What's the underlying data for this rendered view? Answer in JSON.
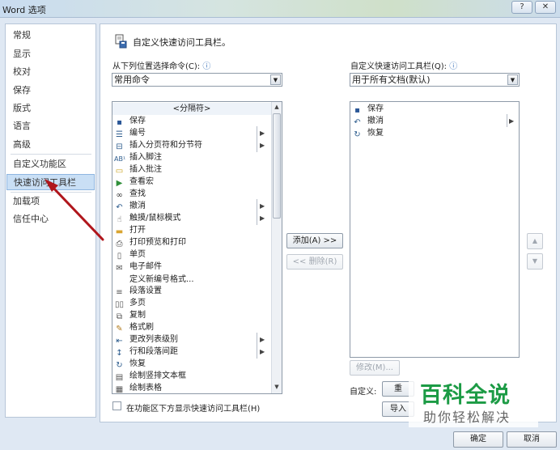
{
  "window": {
    "title": "Word 选项",
    "help_label": "?",
    "close_label": "✕"
  },
  "sidebar": {
    "items": [
      {
        "label": "常规",
        "icon": ""
      },
      {
        "label": "显示"
      },
      {
        "label": "校对"
      },
      {
        "label": "保存"
      },
      {
        "label": "版式"
      },
      {
        "label": "语言"
      },
      {
        "label": "高级"
      },
      {
        "label": "自定义功能区"
      },
      {
        "label": "快速访问工具栏"
      },
      {
        "label": "加载项"
      },
      {
        "label": "信任中心"
      }
    ]
  },
  "main": {
    "heading": "自定义快速访问工具栏。",
    "choose_label": "从下列位置选择命令(C):",
    "choose_value": "常用命令",
    "customize_label": "自定义快速访问工具栏(Q):",
    "customize_value": "用于所有文档(默认)",
    "commands": [
      {
        "label": "<分隔符>",
        "icon": ""
      },
      {
        "label": "保存",
        "icon": "save-icon"
      },
      {
        "label": "编号",
        "icon": "numbering-icon",
        "submenu": true
      },
      {
        "label": "插入分页符和分节符",
        "icon": "page-break-icon",
        "submenu": true
      },
      {
        "label": "插入脚注",
        "icon": "footnote-icon"
      },
      {
        "label": "插入批注",
        "icon": "comment-icon"
      },
      {
        "label": "查看宏",
        "icon": "macro-icon"
      },
      {
        "label": "查找",
        "icon": "binoculars-icon"
      },
      {
        "label": "撤消",
        "icon": "undo-icon",
        "submenu": true
      },
      {
        "label": "触摸/鼠标模式",
        "icon": "touch-icon",
        "submenu": true
      },
      {
        "label": "打开",
        "icon": "folder-icon"
      },
      {
        "label": "打印预览和打印",
        "icon": "print-preview-icon"
      },
      {
        "label": "单页",
        "icon": "one-page-icon"
      },
      {
        "label": "电子邮件",
        "icon": "email-icon"
      },
      {
        "label": "定义新编号格式...",
        "icon": ""
      },
      {
        "label": "段落设置",
        "icon": "paragraph-icon"
      },
      {
        "label": "多页",
        "icon": "multi-page-icon"
      },
      {
        "label": "复制",
        "icon": "copy-icon"
      },
      {
        "label": "格式刷",
        "icon": "format-painter-icon"
      },
      {
        "label": "更改列表级别",
        "icon": "list-level-icon",
        "submenu": true
      },
      {
        "label": "行和段落间距",
        "icon": "line-spacing-icon",
        "submenu": true
      },
      {
        "label": "恢复",
        "icon": "redo-icon"
      },
      {
        "label": "绘制竖排文本框",
        "icon": "vertical-textbox-icon"
      },
      {
        "label": "绘制表格",
        "icon": "draw-table-icon"
      }
    ],
    "toolbar_items": [
      {
        "label": "保存",
        "icon": "save-icon"
      },
      {
        "label": "撤消",
        "icon": "undo-icon",
        "submenu": true
      },
      {
        "label": "恢复",
        "icon": "redo-icon"
      }
    ],
    "add_button": "添加(A) >>",
    "remove_button": "<< 删除(R)",
    "modify_button": "修改(M)...",
    "customize_row_label": "自定义:",
    "reset_button": "重",
    "import_button": "导入",
    "show_below_ribbon": "在功能区下方显示快速访问工具栏(H)"
  },
  "footer": {
    "ok": "确定",
    "cancel": "取消"
  },
  "watermark": {
    "line1": "百科全说",
    "line2": "助你轻松解决"
  },
  "colors": {
    "selection": "#c9dff5",
    "arrow": "#b0161c",
    "watermark_green": "#1c9b45"
  }
}
